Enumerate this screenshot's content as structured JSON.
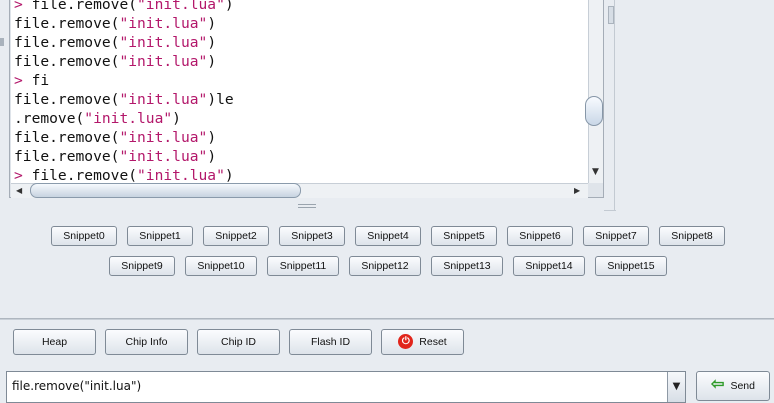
{
  "terminal": {
    "lines": [
      {
        "prompt": "> ",
        "pre": "file.remove(",
        "str": "\"init.lua\"",
        "post": ")"
      },
      {
        "prompt": "",
        "pre": "file.remove(",
        "str": "\"init.lua\"",
        "post": ")"
      },
      {
        "prompt": "",
        "pre": "file.remove(",
        "str": "\"init.lua\"",
        "post": ")"
      },
      {
        "prompt": "",
        "pre": "file.remove(",
        "str": "\"init.lua\"",
        "post": ")"
      },
      {
        "prompt": "> ",
        "pre": "fi",
        "str": "",
        "post": ""
      },
      {
        "prompt": "",
        "pre": "file.remove(",
        "str": "\"init.lua\"",
        "post": ")le"
      },
      {
        "prompt": "",
        "pre": ".remove(",
        "str": "\"init.lua\"",
        "post": ")"
      },
      {
        "prompt": "",
        "pre": "file.remove(",
        "str": "\"init.lua\"",
        "post": ")"
      },
      {
        "prompt": "",
        "pre": "file.remove(",
        "str": "\"init.lua\"",
        "post": ")"
      },
      {
        "prompt": "> ",
        "pre": "file.remove(",
        "str": "\"init.lua\"",
        "post": ")"
      }
    ]
  },
  "snippets": {
    "row1": [
      "Snippet0",
      "Snippet1",
      "Snippet2",
      "Snippet3",
      "Snippet4",
      "Snippet5",
      "Snippet6",
      "Snippet7",
      "Snippet8"
    ],
    "row2": [
      "Snippet9",
      "Snippet10",
      "Snippet11",
      "Snippet12",
      "Snippet13",
      "Snippet14",
      "Snippet15"
    ]
  },
  "controls": {
    "heap": "Heap",
    "chip_info": "Chip Info",
    "chip_id": "Chip ID",
    "flash_id": "Flash ID",
    "reset": "Reset",
    "send": "Send"
  },
  "command": {
    "value": "file.remove(\"init.lua\")"
  },
  "icons": {
    "reset": "power-icon",
    "send": "green-arrow-left-icon",
    "combo": "chevron-down-icon"
  },
  "colors": {
    "string_literal": "#b3176a",
    "reset_icon": "#e1251b",
    "send_icon": "#2f9b2a"
  }
}
